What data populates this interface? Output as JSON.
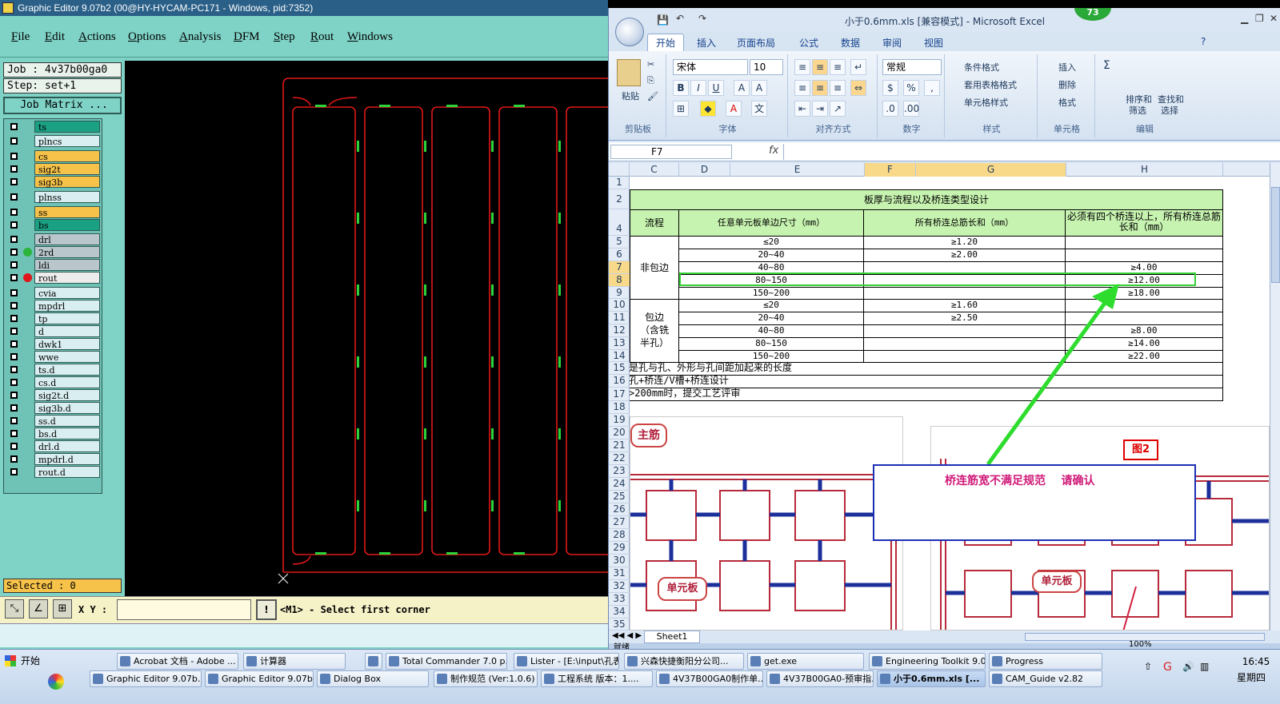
{
  "genesis": {
    "title": "Graphic Editor 9.07b2 (00@HY-HYCAM-PC171 - Windows, pid:7352)",
    "menu": [
      "File",
      "Edit",
      "Actions",
      "Options",
      "Analysis",
      "DFM",
      "Step",
      "Rout",
      "Windows"
    ],
    "job": "Job : 4v37b00ga0",
    "step": "Step: set+1",
    "job_matrix": "Job Matrix ...",
    "layers": [
      {
        "name": "ts",
        "color": "#1aa082",
        "dot": ""
      },
      {
        "name": "plncs",
        "color": "#d9eef1",
        "dot": ""
      },
      {
        "name": "cs",
        "color": "#f6c24a",
        "dot": ""
      },
      {
        "name": "sig2t",
        "color": "#f6c24a",
        "dot": ""
      },
      {
        "name": "sig3b",
        "color": "#f6c24a",
        "dot": ""
      },
      {
        "name": "plnss",
        "color": "#d9eef1",
        "dot": ""
      },
      {
        "name": "ss",
        "color": "#f6c24a",
        "dot": ""
      },
      {
        "name": "bs",
        "color": "#1aa082",
        "dot": ""
      },
      {
        "name": "drl",
        "color": "#b9c7cc",
        "dot": ""
      },
      {
        "name": "2rd",
        "color": "#b9c7cc",
        "dot": "#2bb53a"
      },
      {
        "name": "ldi",
        "color": "#b9c7cc",
        "dot": ""
      },
      {
        "name": "rout",
        "color": "#ececec",
        "dot": "#e0161b"
      },
      {
        "name": "cvia",
        "color": "#d9eef1",
        "dot": ""
      },
      {
        "name": "mpdrl",
        "color": "#d9eef1",
        "dot": ""
      },
      {
        "name": "tp",
        "color": "#d9eef1",
        "dot": ""
      },
      {
        "name": "d",
        "color": "#d9eef1",
        "dot": ""
      },
      {
        "name": "dwk1",
        "color": "#d9eef1",
        "dot": ""
      },
      {
        "name": "wwe",
        "color": "#d9eef1",
        "dot": ""
      },
      {
        "name": "ts.d",
        "color": "#d9eef1",
        "dot": ""
      },
      {
        "name": "cs.d",
        "color": "#d9eef1",
        "dot": ""
      },
      {
        "name": "sig2t.d",
        "color": "#d9eef1",
        "dot": ""
      },
      {
        "name": "sig3b.d",
        "color": "#d9eef1",
        "dot": ""
      },
      {
        "name": "ss.d",
        "color": "#d9eef1",
        "dot": ""
      },
      {
        "name": "bs.d",
        "color": "#d9eef1",
        "dot": ""
      },
      {
        "name": "drl.d",
        "color": "#d9eef1",
        "dot": ""
      },
      {
        "name": "mpdrl.d",
        "color": "#d9eef1",
        "dot": ""
      },
      {
        "name": "rout.d",
        "color": "#d9eef1",
        "dot": ""
      }
    ],
    "selected": "Selected : 0",
    "xy_label": "X Y :",
    "xy_value": "",
    "warn_symbol": "!",
    "message": "<M1> - Select first corner"
  },
  "excel": {
    "title": "小于0.6mm.xls  [兼容模式] - Microsoft Excel",
    "badge": "73",
    "tabs": [
      "开始",
      "插入",
      "页面布局",
      "公式",
      "数据",
      "审阅",
      "视图"
    ],
    "ribbon": {
      "paste": "粘贴",
      "font_name": "宋体",
      "font_size": "10",
      "number_format": "常规",
      "groups": [
        "剪贴板",
        "字体",
        "对齐方式",
        "数字",
        "样式",
        "单元格",
        "编辑"
      ],
      "style_items": [
        "条件格式",
        "套用表格格式",
        "单元格样式"
      ],
      "cell_items": [
        "插入",
        "删除",
        "格式"
      ],
      "edit_items": [
        "排序和",
        "筛选",
        "查找和",
        "选择"
      ]
    },
    "name_box": "F7",
    "fx": "fx",
    "columns": [
      "C",
      "D",
      "E",
      "F",
      "G",
      "H"
    ],
    "rows": [
      "1",
      "2",
      "4",
      "5",
      "6",
      "7",
      "8",
      "9",
      "10",
      "11",
      "12",
      "13",
      "14",
      "15",
      "16",
      "17",
      "18",
      "19",
      "20",
      "21",
      "22",
      "23",
      "24",
      "25",
      "26",
      "27",
      "28",
      "29",
      "30",
      "31",
      "32",
      "33",
      "34",
      "35"
    ],
    "table": {
      "title": "板厚与流程以及桥连类型设计",
      "h_flow": "流程",
      "h_size": "任意单元板单边尺寸（mm）",
      "h_total": "所有桥连总筋长和（mm）",
      "h_four": "必须有四个桥连以上，所有桥连总筋长和（mm）",
      "group1": "非包边",
      "group2": "包边（含铣半孔）",
      "g1": [
        {
          "size": "≤20",
          "total": "≥1.20",
          "four": ""
        },
        {
          "size": "20~40",
          "total": "≥2.00",
          "four": ""
        },
        {
          "size": "40~80",
          "total": "",
          "four": "≥4.00"
        },
        {
          "size": "80~150",
          "total": "",
          "four": "≥12.00"
        },
        {
          "size": "150~200",
          "total": "",
          "four": "≥18.00"
        }
      ],
      "g2": [
        {
          "size": "≤20",
          "total": "≥1.60",
          "four": ""
        },
        {
          "size": "20~40",
          "total": "≥2.50",
          "four": ""
        },
        {
          "size": "40~80",
          "total": "",
          "four": "≥8.00"
        },
        {
          "size": "80~150",
          "total": "",
          "four": "≥14.00"
        },
        {
          "size": "150~200",
          "total": "",
          "four": "≥22.00"
        }
      ],
      "note15": "是孔与孔、外形与孔间距加起来的长度",
      "note16": "孔+桥连/V槽+桥连设计",
      "note17": ">200mm时，提交工艺评审"
    },
    "img_labels": {
      "main_rib": "主筋",
      "unit_board": "单元板",
      "fig2": "图2"
    },
    "comment": "桥连筋宽不满足规范    请确认",
    "sheet": "Sheet1",
    "status": "就绪",
    "zoom": "100%"
  },
  "taskbar": {
    "start": "开始",
    "row1": [
      "Acrobat 文档 - Adobe ...",
      "计算器",
      "",
      "Total Commander 7.0 p...",
      "Lister - [E:\\input\\孔表...",
      "兴森快捷衡阳分公司...",
      "get.exe",
      "Engineering Toolkit 9.0...",
      "Progress"
    ],
    "row2": [
      "Graphic Editor 9.07b...",
      "Graphic Editor 9.07b...",
      "Dialog Box",
      "制作规范 (Ver:1.0.6)",
      "工程系统  版本：1....",
      "4V37B00GA0制作单...",
      "4V37B00GA0-预审指...",
      "小于0.6mm.xls  [...",
      "CAM_Guide v2.82"
    ],
    "time": "16:45",
    "weekday": "星期四"
  }
}
